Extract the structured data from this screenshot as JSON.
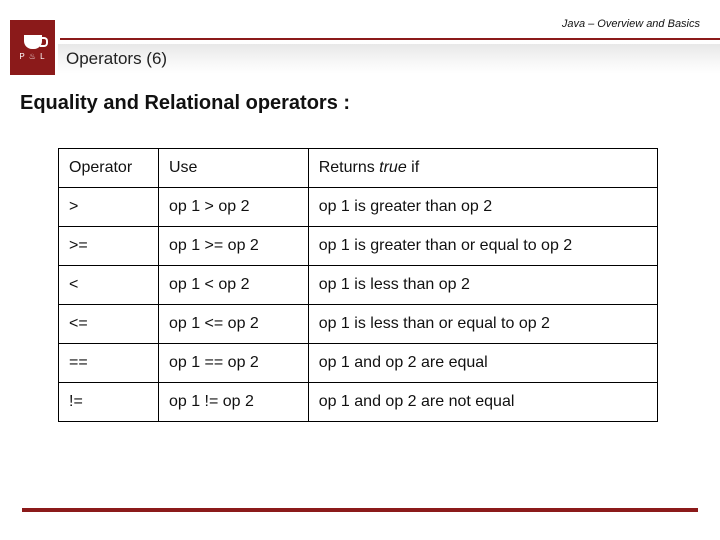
{
  "header": {
    "breadcrumb": "Java – Overview and Basics",
    "logo_text": "P ♨ L",
    "title": "Operators (6)"
  },
  "section_title": "Equality and Relational operators :",
  "table": {
    "headers": {
      "c0": "Operator",
      "c1": "Use",
      "c2a": "Returns ",
      "c2b": "true",
      "c2c": " if"
    },
    "rows": [
      {
        "op": ">",
        "use": " op 1 > op 2",
        "ret": "op 1 is greater than op 2"
      },
      {
        "op": ">=",
        "use": "op 1 >= op 2",
        "ret": "op 1 is greater than or equal to op 2"
      },
      {
        "op": "<",
        "use": "op 1 < op 2",
        "ret": "op 1 is less than op 2"
      },
      {
        "op": "<=",
        "use": "op 1 <= op 2",
        "ret": "op 1 is less than or equal to op 2"
      },
      {
        "op": "==",
        "use": "op 1 == op 2",
        "ret": "op 1 and op 2 are equal"
      },
      {
        "op": "!=",
        "use": "op 1 != op 2",
        "ret": "op 1 and op 2 are not equal"
      }
    ]
  }
}
